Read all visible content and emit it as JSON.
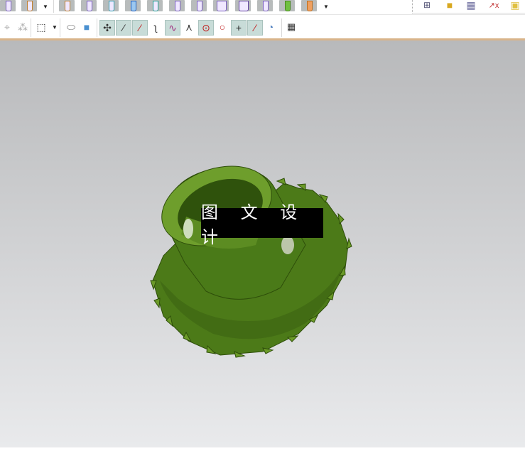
{
  "watermark": {
    "text": "图 文 设 计"
  },
  "icons": {
    "row1": [
      "hole-tool-1",
      "hole-tool-2",
      "hole-tool-3",
      "hole-tool-4",
      "hole-tool-5",
      "hole-tool-6",
      "hole-tool-7",
      "hole-tool-8",
      "hole-tool-9",
      "hole-tool-10",
      "hole-tool-11",
      "hole-tool-12",
      "hole-tool-13",
      "hole-tool-14"
    ],
    "row2": [
      "move-icon",
      "pattern-icon",
      "select-box-icon",
      "view-shaded-icon",
      "view-cube-icon",
      "snap-all-icon",
      "snap-endpoint-icon",
      "snap-midpoint-icon",
      "snap-curve-icon",
      "snap-control-icon",
      "snap-intersection-icon",
      "snap-center-icon",
      "snap-quadrant-icon",
      "snap-point-icon",
      "snap-on-curve-icon",
      "snap-face-icon",
      "grid-icon"
    ]
  },
  "colors": {
    "gear": "#5a8a1e",
    "accent": "#d9b48a"
  }
}
